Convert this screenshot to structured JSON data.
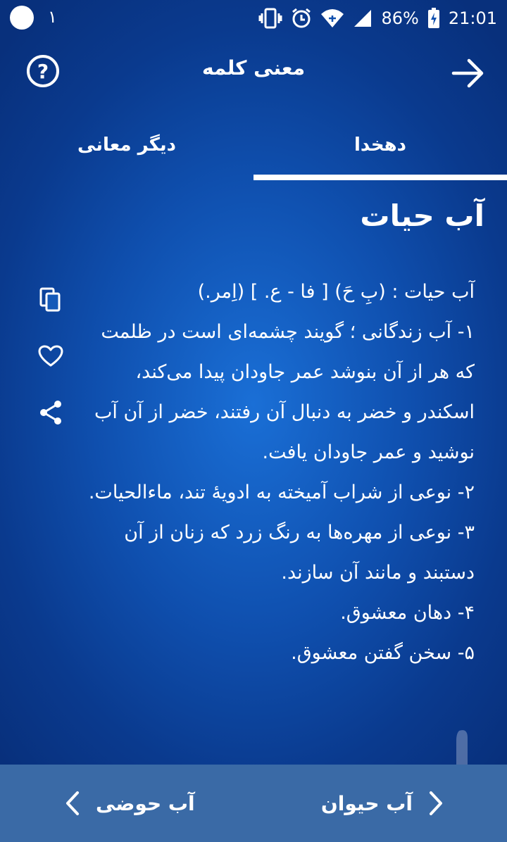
{
  "status_bar": {
    "notification_count": "۱",
    "battery": "86%",
    "time": "21:01"
  },
  "app_bar": {
    "title": "معنی کلمه",
    "help_icon": "?"
  },
  "tabs": [
    {
      "label": "دهخدا",
      "selected": true
    },
    {
      "label": "دیگر معانی",
      "selected": false
    }
  ],
  "entry": {
    "word": "آب حیات",
    "lines": [
      "آب حیات : (بِ حَ) [ فا - ع. ] (اِمر.)",
      "۱- آب زندگانی ؛ گویند چشمه‌ای است در ظلمت که هر از آن بنوشد عمر جاودان پیدا می‌کند، اسکندر و خضر به دنبال آن رفتند، خضر از آن آب نوشید و عمر جاودان یافت.",
      "۲- نوعی از شراب آمیخته به ادویهٔ تند، ماءالحیات.",
      "۳- نوعی از مهره‌ها به رنگ زرد که زنان از آن دستبند و مانند آن سازند.",
      "۴- دهان معشوق.",
      "۵- سخن گفتن معشوق."
    ]
  },
  "side_actions": [
    "copy-icon",
    "heart-icon",
    "share-icon"
  ],
  "bottom_nav": {
    "previous": "آب حیوان",
    "next": "آب حوضی"
  },
  "colors": {
    "background": "#0f4fae",
    "bottom_bar": "#3a6aa6",
    "text": "#ffffff"
  }
}
